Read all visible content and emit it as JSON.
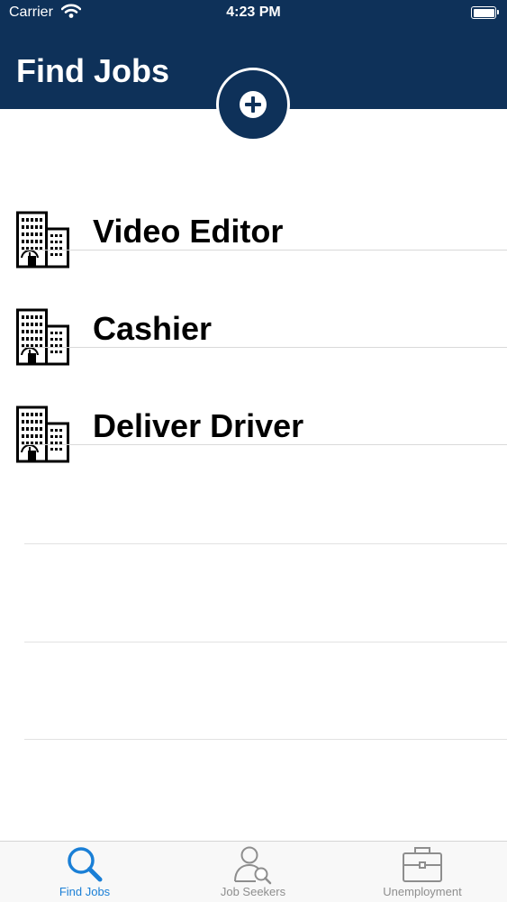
{
  "status_bar": {
    "carrier": "Carrier",
    "time": "4:23 PM"
  },
  "header": {
    "title": "Find Jobs",
    "add_icon": "plus-circle-icon"
  },
  "jobs": [
    {
      "title": "Video Editor",
      "icon": "building-icon"
    },
    {
      "title": "Cashier",
      "icon": "building-icon"
    },
    {
      "title": "Deliver Driver",
      "icon": "building-icon"
    }
  ],
  "tabs": [
    {
      "label": "Find Jobs",
      "icon": "search-icon",
      "active": true
    },
    {
      "label": "Job Seekers",
      "icon": "person-search-icon",
      "active": false
    },
    {
      "label": "Unemployment",
      "icon": "briefcase-icon",
      "active": false
    }
  ],
  "colors": {
    "header_bg": "#0e3159",
    "active_tab": "#1a7fd6",
    "inactive_tab": "#8e8e8e"
  }
}
